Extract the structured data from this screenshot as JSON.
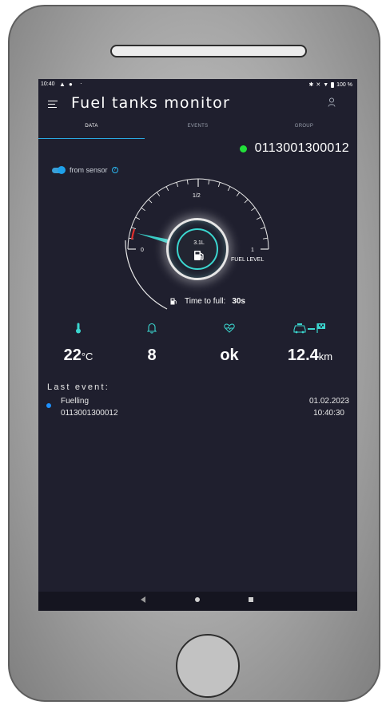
{
  "status_bar": {
    "time": "10:40",
    "battery": "100 %"
  },
  "app": {
    "title": "Fuel tanks monitor"
  },
  "tabs": [
    {
      "label": "DATA",
      "active": true
    },
    {
      "label": "EVENTS",
      "active": false
    },
    {
      "label": "GROUP",
      "active": false
    }
  ],
  "device": {
    "id": "0113001300012",
    "online_color": "#22e03a"
  },
  "source": {
    "label": "from sensor",
    "enabled": true
  },
  "gauge": {
    "value_label": "3.1L",
    "min_label": "0",
    "mid_label": "1/2",
    "max_label": "1",
    "caption": "FUEL LEVEL",
    "needle_fraction": 0.1,
    "accent": "#3bd6cf",
    "low_zone": "#e0302f"
  },
  "time_to_full": {
    "label": "Time to full:",
    "value": "30s"
  },
  "stats": {
    "temperature": {
      "value": "22",
      "unit": "°C",
      "icon": "thermometer-icon"
    },
    "alarms": {
      "value": "8",
      "icon": "bell-icon"
    },
    "health": {
      "value": "ok",
      "icon": "heart-pulse-icon"
    },
    "distance": {
      "value": "12.4",
      "unit": "km",
      "icon": "car-route-icon"
    }
  },
  "last_event": {
    "heading": "Last event:",
    "name": "Fuelling",
    "device_id": "0113001300012",
    "date": "01.02.2023",
    "time": "10:40:30",
    "dot_color": "#1e90ff"
  }
}
